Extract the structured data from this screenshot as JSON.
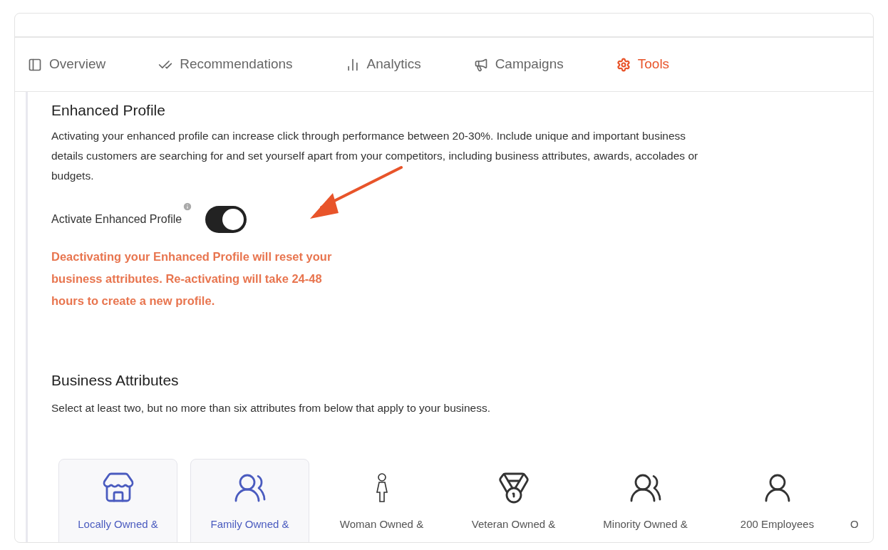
{
  "tabs": [
    {
      "label": "Overview",
      "kind": "overview",
      "selected": false
    },
    {
      "label": "Recommendations",
      "kind": "checks",
      "selected": false
    },
    {
      "label": "Analytics",
      "kind": "chart",
      "selected": false
    },
    {
      "label": "Campaigns",
      "kind": "megaphone",
      "selected": false
    },
    {
      "label": "Tools",
      "kind": "gear",
      "selected": true
    }
  ],
  "enhanced_profile": {
    "title": "Enhanced Profile",
    "description": "Activating your enhanced profile can increase click through performance between 20-30%. Include unique and important business details customers are searching for and set yourself apart from your competitors, including business attributes, awards, accolades or budgets.",
    "toggle_label": "Activate Enhanced Profile",
    "toggle_on": true,
    "warning": "Deactivating your Enhanced Profile will reset your business attributes. Re-activating will take 24-48 hours to create a new profile."
  },
  "business_attributes": {
    "title": "Business Attributes",
    "description": "Select at least two, but no more than six attributes from below that apply to your business.",
    "items": [
      {
        "label": "Locally Owned &",
        "kind": "store",
        "selected": true
      },
      {
        "label": "Family Owned &",
        "kind": "group",
        "selected": true
      },
      {
        "label": "Woman Owned &",
        "kind": "woman",
        "selected": false
      },
      {
        "label": "Veteran Owned &",
        "kind": "medal",
        "selected": false
      },
      {
        "label": "Minority Owned &",
        "kind": "group",
        "selected": false
      },
      {
        "label": "200 Employees",
        "kind": "employee",
        "selected": false
      },
      {
        "label": "O",
        "kind": "none",
        "selected": false
      }
    ]
  }
}
